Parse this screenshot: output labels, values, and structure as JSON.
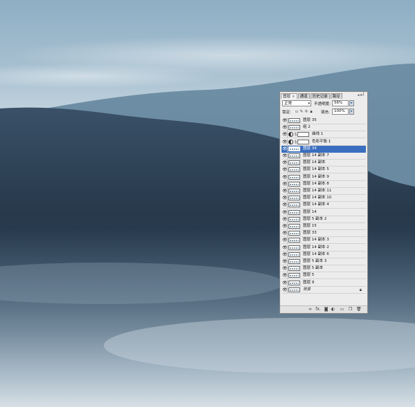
{
  "panel": {
    "tabs": [
      {
        "label": "图层",
        "close": "×"
      },
      {
        "label": "通道"
      },
      {
        "label": "历史记录"
      },
      {
        "label": "路径"
      }
    ],
    "menu_icon": "panel-menu-icon",
    "blend_mode": "正常",
    "opacity_label": "不透明度:",
    "opacity_value": "56%",
    "lock_label": "锁定:",
    "fill_label": "填充:",
    "fill_value": "100%",
    "layers": [
      {
        "name": "图层 35",
        "kind": "pixel"
      },
      {
        "name": "组 2",
        "kind": "pixel"
      },
      {
        "name": "曲线 1",
        "kind": "adjustment"
      },
      {
        "name": "色彩平衡 1",
        "kind": "adjustment"
      },
      {
        "name": "图层 34",
        "kind": "pixel",
        "selected": true
      },
      {
        "name": "图层 14 副本 7",
        "kind": "pixel"
      },
      {
        "name": "图层 14 副本",
        "kind": "pixel"
      },
      {
        "name": "图层 14 副本 5",
        "kind": "pixel"
      },
      {
        "name": "图层 14 副本 9",
        "kind": "pixel"
      },
      {
        "name": "图层 14 副本 8",
        "kind": "pixel"
      },
      {
        "name": "图层 14 副本 11",
        "kind": "pixel"
      },
      {
        "name": "图层 14 副本 10",
        "kind": "pixel"
      },
      {
        "name": "图层 14 副本 4",
        "kind": "pixel"
      },
      {
        "name": "图层 14",
        "kind": "pixel"
      },
      {
        "name": "图层 5 副本 2",
        "kind": "pixel"
      },
      {
        "name": "图层 15",
        "kind": "pixel"
      },
      {
        "name": "图层 33",
        "kind": "pixel"
      },
      {
        "name": "图层 14 副本 3",
        "kind": "pixel"
      },
      {
        "name": "图层 14 副本 2",
        "kind": "pixel"
      },
      {
        "name": "图层 14 副本 6",
        "kind": "pixel"
      },
      {
        "name": "图层 5 副本 3",
        "kind": "pixel"
      },
      {
        "name": "图层 5 副本",
        "kind": "pixel"
      },
      {
        "name": "图层 5",
        "kind": "pixel"
      },
      {
        "name": "图层 9",
        "kind": "pixel"
      },
      {
        "name": "背景",
        "kind": "background"
      }
    ],
    "footer_icons": [
      "link-layers-icon",
      "fx-icon",
      "add-mask-icon",
      "adjustment-layer-icon",
      "new-group-icon",
      "new-layer-icon",
      "trash-icon"
    ],
    "footer_fx": "fx."
  },
  "colors": {
    "selected": "#3a6fbf",
    "sky_top": "#8faec4",
    "mountain_dark": "#26394b"
  }
}
